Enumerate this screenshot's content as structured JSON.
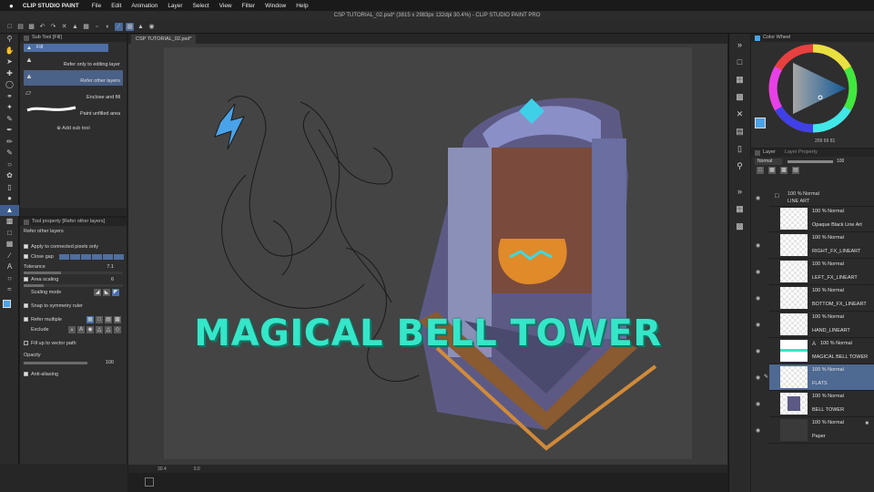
{
  "menubar": {
    "apple": "",
    "app": "CLIP STUDIO PAINT",
    "items": [
      "File",
      "Edit",
      "Animation",
      "Layer",
      "Select",
      "View",
      "Filter",
      "Window",
      "Help"
    ]
  },
  "window_title": "CSP TUTORIAL_02.psd* (3815 x 2983px 132dpi 30.4%) - CLIP STUDIO PAINT PRO",
  "doc_tab": "CSP TUTORIAL_02.psd*",
  "subtool": {
    "header": "Sub Tool [Fill]",
    "group_tab": "Fill",
    "items": [
      {
        "label": "Refer only to editing layer",
        "active": false
      },
      {
        "label": "Refer other layers",
        "active": true
      },
      {
        "label": "Enclose and fill",
        "active": false
      },
      {
        "label": "Paint unfilled area",
        "active": false
      }
    ],
    "add_label": "Add sub tool"
  },
  "toolprop": {
    "header": "Tool property [Refer other layers]",
    "subtitle": "Refer other layers",
    "apply_connected": "Apply to connected pixels only",
    "close_gap": "Close gap",
    "tolerance_label": "Tolerance",
    "tolerance_value": "7.1",
    "area_scaling": "Area scaling",
    "area_scaling_value": "6",
    "scaling_mode": "Scaling mode",
    "snap_symmetry": "Snap to symmetry ruler",
    "refer_multiple": "Refer multiple",
    "exclude": "Exclude",
    "fill_vector": "Fill up to vector path",
    "opacity_label": "Opacity",
    "opacity_value": "100",
    "antialiasing": "Anti-aliasing"
  },
  "canvas": {
    "headline": "MAGICAL BELL TOWER",
    "zoom": "30.4",
    "angle": "0.0"
  },
  "color_panel": {
    "header": "Color Wheel",
    "hex_readout": "209",
    "readout2": "69",
    "readout3": "81"
  },
  "layer_panel": {
    "header": "Layer",
    "tab2": "Layer Property",
    "blend_mode": "Normal",
    "opacity": "100",
    "folder": {
      "info": "100 % Normal",
      "name": "LINE ART"
    },
    "layers": [
      {
        "info": "100 % Normal",
        "name": "Opaque Black Line Art",
        "selected": false
      },
      {
        "info": "100 % Normal",
        "name": "RIGHT_FX_LINEART",
        "selected": false
      },
      {
        "info": "100 % Normal",
        "name": "LEFT_FX_LINEART",
        "selected": false
      },
      {
        "info": "100 % Normal",
        "name": "BOTTOM_FX_LINEART",
        "selected": false
      },
      {
        "info": "100 % Normal",
        "name": "HAND_LINEART",
        "selected": false
      },
      {
        "info": "100 % Normal",
        "name": "MAGICAL BELL TOWER",
        "selected": false
      },
      {
        "info": "100 % Normal",
        "name": "FLATS",
        "selected": true
      },
      {
        "info": "100 % Normal",
        "name": "BELL TOWER",
        "selected": false
      },
      {
        "info": "100 % Normal",
        "name": "Paper",
        "selected": false
      }
    ]
  },
  "colors": {
    "accent": "#4d6fa3",
    "headline": "#35e6c8",
    "main_color": "#4aa3e8"
  }
}
